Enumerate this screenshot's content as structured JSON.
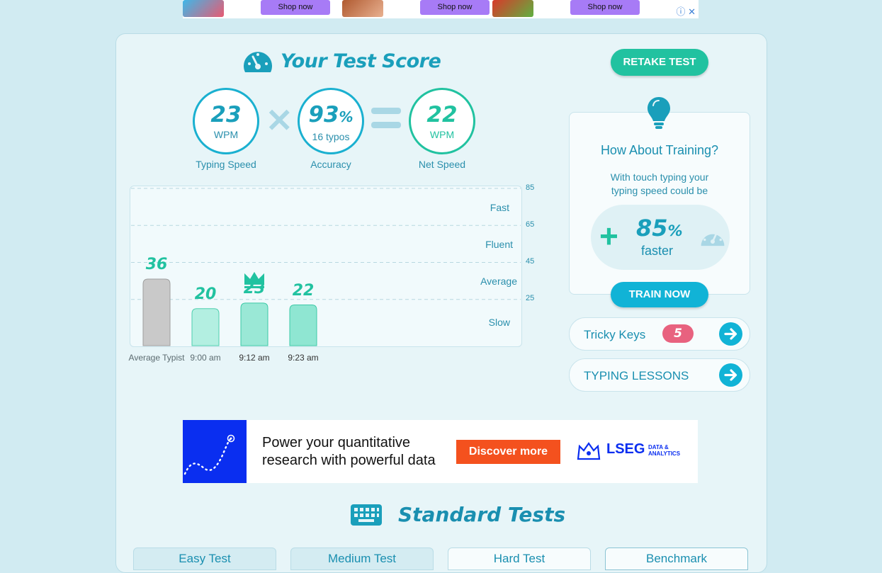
{
  "top_ad": {
    "buttons": [
      "Shop now",
      "Shop now",
      "Shop now"
    ],
    "info_icon": "info-icon",
    "close_icon": "close-icon"
  },
  "score": {
    "title": "Your Test Score",
    "retake_label": "RETAKE TEST",
    "typing_speed": {
      "value": "23",
      "unit": "WPM",
      "label": "Typing Speed"
    },
    "accuracy": {
      "value": "93",
      "percent": "%",
      "sub": "16 typos",
      "label": "Accuracy"
    },
    "net_speed": {
      "value": "22",
      "unit": "WPM",
      "label": "Net Speed"
    }
  },
  "chart_data": {
    "type": "bar",
    "categories": [
      "Average Typist",
      "9:00 am",
      "9:12 am",
      "9:23 am"
    ],
    "values": [
      36,
      20,
      23,
      22
    ],
    "y_ticks": [
      "85",
      "65",
      "45",
      "25"
    ],
    "bands": [
      "Fast",
      "Fluent",
      "Average",
      "Slow"
    ],
    "ylim": [
      0,
      85
    ],
    "best_marker": "crown-icon on 9:12 am",
    "colors": {
      "average": "#c9c9c9",
      "results": "#9ae8d6",
      "labels": "#21c2a0"
    }
  },
  "training": {
    "title": "How About Training?",
    "sub_line1": "With touch typing your",
    "sub_line2": "typing speed could be",
    "plus": "+",
    "percent_value": "85",
    "percent_sign": "%",
    "faster": "faster",
    "train_label": "TRAIN NOW"
  },
  "sidebar": {
    "tricky_keys_label": "Tricky Keys",
    "tricky_keys_count": "5",
    "lessons_label": "TYPING LESSONS"
  },
  "mid_ad": {
    "line1": "Power your quantitative",
    "line2": "research with powerful data",
    "cta": "Discover more",
    "brand": "LSEG",
    "brand_sub1": "DATA &",
    "brand_sub2": "ANALYTICS"
  },
  "standard_tests": {
    "title": "Standard Tests",
    "tabs": [
      "Easy Test",
      "Medium Test",
      "Hard Test",
      "Benchmark"
    ]
  }
}
